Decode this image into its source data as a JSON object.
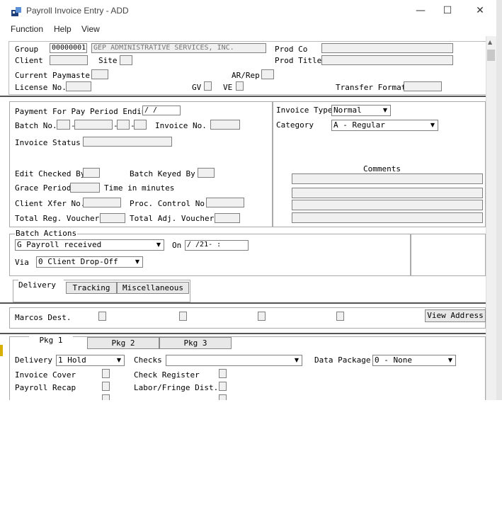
{
  "window": {
    "title": "Payroll Invoice Entry - ADD",
    "minimize_glyph": "—",
    "maximize_glyph": "☐",
    "close_glyph": "✕"
  },
  "menu": [
    "Function",
    "Help",
    "View"
  ],
  "header": {
    "group_label": "Group",
    "group_code": "00000001",
    "group_name": "GEP ADMINISTRATIVE SERVICES, INC.",
    "client_label": "Client",
    "site_label": "Site",
    "prod_co_label": "Prod Co",
    "prod_title_label": "Prod Title",
    "current_paymaster_label": "Current Paymaster",
    "ar_rep_label": "AR/Rep",
    "license_label": "License No.",
    "gv_label": "GV",
    "ve_label": "VE",
    "transfer_format_label": "Transfer Format"
  },
  "payment": {
    "pay_period_label": "Payment For Pay Period Ending",
    "pay_period_value": "  /  /",
    "batch_label": "Batch No.",
    "invoice_no_label": "Invoice No.",
    "invoice_status_label": "Invoice Status",
    "edit_checked_label": "Edit Checked By",
    "batch_keyed_label": "Batch Keyed By",
    "grace_period_label": "Grace Period",
    "time_minutes_label": "Time in minutes",
    "client_xfer_label": "Client Xfer No.",
    "proc_control_label": "Proc. Control No.",
    "total_reg_label": "Total Reg. Vouchers",
    "total_adj_label": "Total Adj. Vouchers"
  },
  "invoice_type": {
    "label": "Invoice Type",
    "value": "Normal",
    "category_label": "Category",
    "category_value": "A - Regular",
    "comments_label": "Comments"
  },
  "batch_actions": {
    "title": "Batch Actions",
    "action_value": "G Payroll received",
    "on_label": "On",
    "on_value": "  /  /21-   :",
    "via_label": "Via",
    "via_value": "0 Client Drop-Off"
  },
  "tabs": [
    "Delivery",
    "Tracking",
    "Miscellaneous"
  ],
  "marcos": {
    "label": "Marcos Dest.",
    "view_address_label": "View Address"
  },
  "pkg_tabs": [
    "Pkg 1",
    "Pkg 2",
    "Pkg 3"
  ],
  "pkg": {
    "delivery_label": "Delivery",
    "delivery_value": "1 Hold",
    "checks_label": "Checks",
    "checks_value": "",
    "data_package_label": "Data Package",
    "data_package_value": "0 - None",
    "invoice_cover_label": "Invoice Cover",
    "payroll_recap_label": "Payroll Recap",
    "check_register_label": "Check Register",
    "labor_fringe_label": "Labor/Fringe Dist."
  },
  "colors": {
    "accent_marker": "#d8b000",
    "field_bg": "#f0f0f0",
    "border": "#808080"
  }
}
